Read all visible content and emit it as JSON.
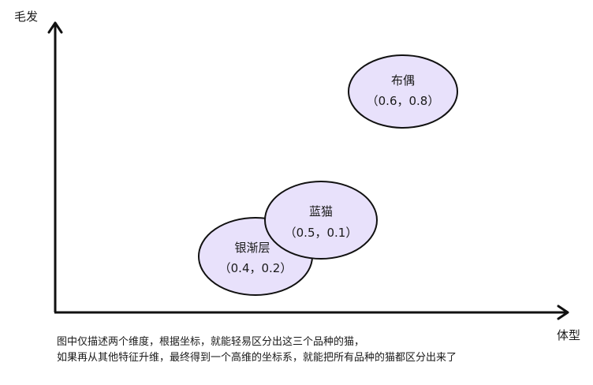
{
  "axes": {
    "y_label": "毛发",
    "x_label": "体型"
  },
  "nodes": [
    {
      "id": "buou",
      "name": "布偶",
      "coord": "（0.6，0.8）"
    },
    {
      "id": "yinjianceng",
      "name": "银渐层",
      "coord": "（0.4，0.2）"
    },
    {
      "id": "lanmao",
      "name": "蓝猫",
      "coord": "（0.5，0.1）"
    }
  ],
  "caption": {
    "line1": "图中仅描述两个维度，根据坐标，就能轻易区分出这三个品种的猫，",
    "line2": "如果再从其他特征升维，最终得到一个高维的坐标系，就能把所有品种的猫都区分出来了"
  },
  "colors": {
    "node_fill": "#e8e1fb",
    "node_stroke": "#111111",
    "axis": "#111111"
  }
}
